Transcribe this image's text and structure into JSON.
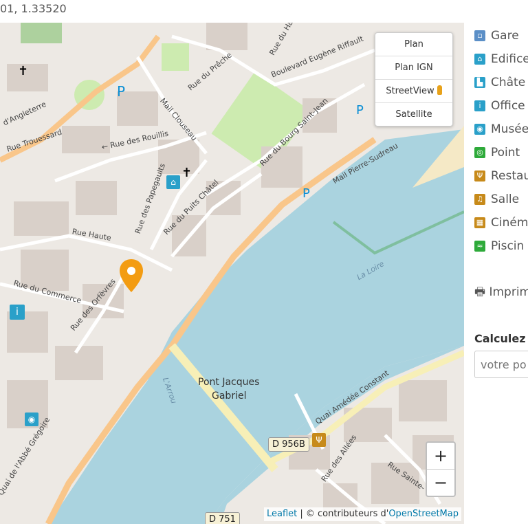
{
  "header": {
    "coords": "01, 1.33520"
  },
  "layers": {
    "items": [
      "Plan",
      "Plan IGN",
      "StreetView",
      "Satellite"
    ]
  },
  "zoom": {
    "in": "+",
    "out": "−"
  },
  "attribution": {
    "leaflet": "Leaflet",
    "sep": " | © contributeurs d'",
    "osm": "OpenStreetMap"
  },
  "map_labels": {
    "angleterre": "d'Angleterre",
    "trouessard": "Rue Trouessard",
    "rouillis": "← Rue des Rouillis",
    "preche": "Rue du Prêche",
    "clouseau": "Mail Clouseau",
    "riffault": "Boulevard Eugène Riffault",
    "bourg": "Rue du Bourg Saint-Jean",
    "pierre": "Mail Pierre-Sudreau",
    "haute": "Rue Haute",
    "papegaults": "Rue des Papegaults",
    "puits": "Rue du Puits Châtel",
    "commerce": "Rue du Commerce",
    "orfevres": "Rue des Orfèvres",
    "loire": "La Loire",
    "arrou": "L'Arrou",
    "pont": "Pont Jacques",
    "pont2": "Gabriel",
    "amedee": "Quai Amédée Constant",
    "gregoire": "Quai de l'Abbé Grégoire",
    "allees": "Rue des Allées",
    "sainte": "Rue Sainte-",
    "haut": "Rue du Haut",
    "d956": "D 956B",
    "d751": "D 751"
  },
  "sidebar": {
    "items": [
      {
        "label": "Gare",
        "icon": "train-icon",
        "color": "#5b8fc7"
      },
      {
        "label": "Edifice",
        "icon": "monument-icon",
        "color": "#2aa0c9"
      },
      {
        "label": "Châte",
        "icon": "castle-icon",
        "color": "#2aa0c9"
      },
      {
        "label": "Office",
        "icon": "info-icon",
        "color": "#2aa0c9"
      },
      {
        "label": "Musée",
        "icon": "museum-icon",
        "color": "#2aa0c9"
      },
      {
        "label": "Point",
        "icon": "viewpoint-icon",
        "color": "#2eaa3a"
      },
      {
        "label": "Restau",
        "icon": "restaurant-icon",
        "color": "#c78a1a"
      },
      {
        "label": "Salle",
        "icon": "music-icon",
        "color": "#c78a1a"
      },
      {
        "label": "Ciném",
        "icon": "cinema-icon",
        "color": "#c78a1a"
      },
      {
        "label": "Piscin",
        "icon": "pool-icon",
        "color": "#2eaa3a"
      }
    ]
  },
  "print": {
    "label": "Imprim"
  },
  "calc": {
    "title": "Calculez",
    "placeholder": "votre po"
  }
}
